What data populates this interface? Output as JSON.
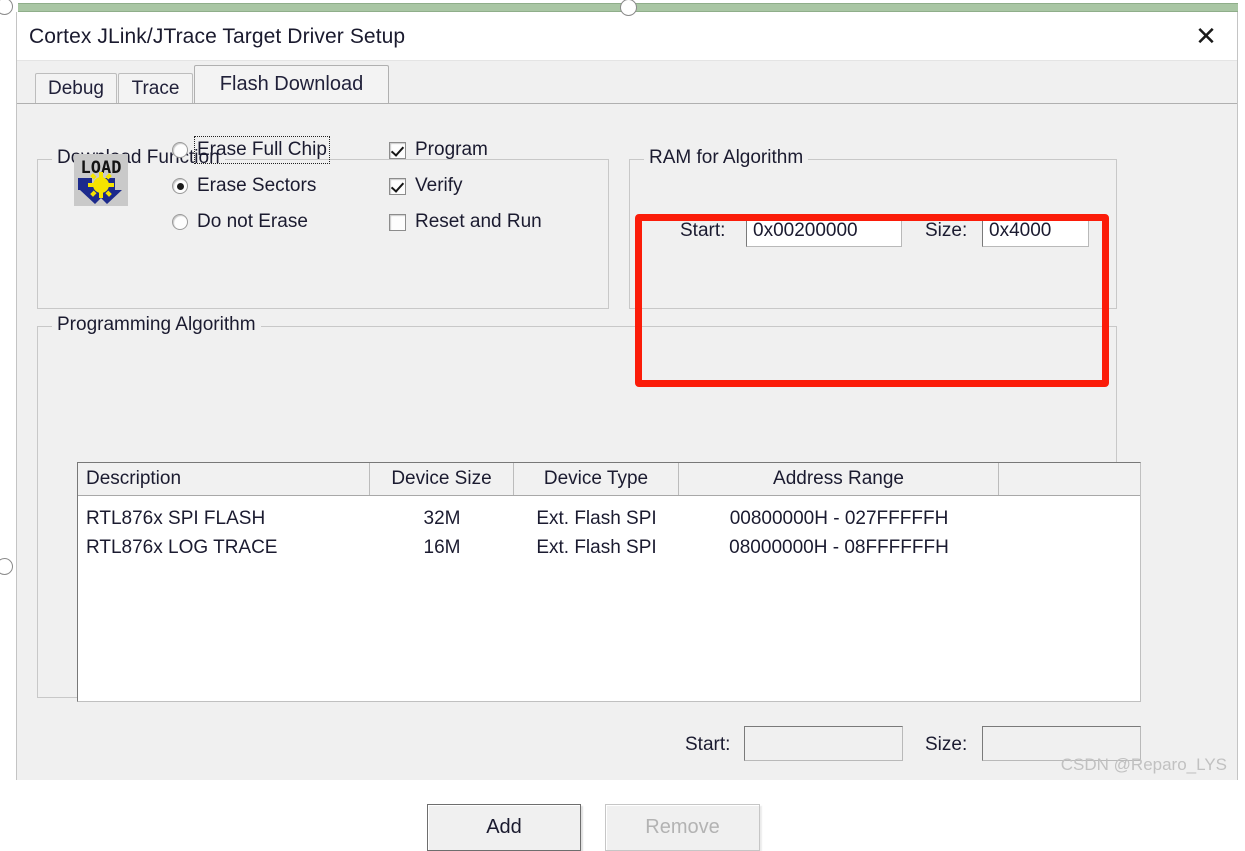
{
  "window": {
    "title": "Cortex JLink/JTrace Target Driver Setup",
    "close_label": "✕"
  },
  "tabs": [
    {
      "label": "Debug",
      "active": false
    },
    {
      "label": "Trace",
      "active": false
    },
    {
      "label": "Flash Download",
      "active": true
    }
  ],
  "download_function": {
    "title": "Download Function",
    "icon": "load-download-icon",
    "icon_text": "LOAD",
    "radios": [
      {
        "label": "Erase Full Chip",
        "checked": false,
        "focused": true
      },
      {
        "label": "Erase Sectors",
        "checked": true,
        "focused": false
      },
      {
        "label": "Do not Erase",
        "checked": false,
        "focused": false
      }
    ],
    "checkboxes": [
      {
        "label": "Program",
        "checked": true
      },
      {
        "label": "Verify",
        "checked": true
      },
      {
        "label": "Reset and Run",
        "checked": false
      }
    ]
  },
  "ram_for_algorithm": {
    "title": "RAM for Algorithm",
    "start_label": "Start:",
    "start_value": "0x00200000",
    "size_label": "Size:",
    "size_value": "0x4000",
    "highlight_color": "#fb1c09"
  },
  "programming_algorithm": {
    "title": "Programming Algorithm",
    "columns": [
      "Description",
      "Device Size",
      "Device Type",
      "Address Range",
      ""
    ],
    "rows": [
      {
        "description": "RTL876x SPI FLASH",
        "device_size": "32M",
        "device_type": "Ext. Flash SPI",
        "address_range": "00800000H - 027FFFFFH",
        "tail": ""
      },
      {
        "description": "RTL876x LOG TRACE",
        "device_size": "16M",
        "device_type": "Ext. Flash SPI",
        "address_range": "08000000H - 08FFFFFFH",
        "tail": ""
      }
    ],
    "start_label": "Start:",
    "start_value": "",
    "size_label": "Size:",
    "size_value": ""
  },
  "buttons": {
    "add": "Add",
    "remove": "Remove"
  },
  "watermark": "CSDN @Reparo_LYS"
}
